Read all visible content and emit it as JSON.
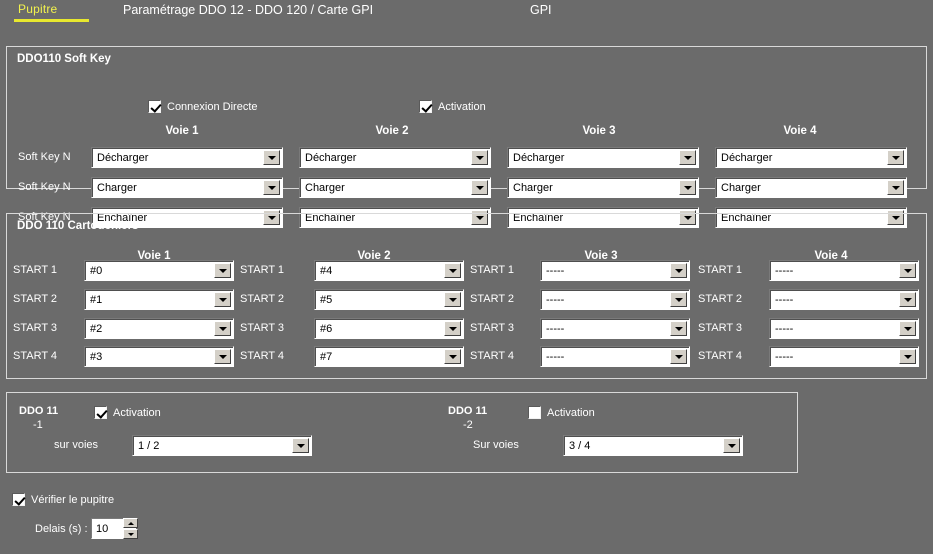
{
  "topbar": {
    "tab_label": "Pupitre",
    "title": "Paramétrage DDO 12 - DDO 120 / Carte GPI",
    "right_label": "GPI"
  },
  "softkey_panel": {
    "title": "DDO110 Soft Key",
    "connexion_directe": {
      "label": "Connexion Directe",
      "checked": true
    },
    "activation": {
      "label": "Activation",
      "checked": true
    },
    "column_headers": [
      "Voie 1",
      "Voie 2",
      "Voie 3",
      "Voie 4"
    ],
    "row_labels": [
      "Soft Key N",
      "Soft Key N",
      "Soft Key N"
    ],
    "values": [
      [
        "Décharger",
        "Décharger",
        "Décharger",
        "Décharger"
      ],
      [
        "Charger",
        "Charger",
        "Charger",
        "Charger"
      ],
      [
        "Enchaîner",
        "Enchaîner",
        "Enchaîner",
        "Enchaîner"
      ]
    ]
  },
  "cartouchiers_panel": {
    "title": "DDO 110 Cartouchiers",
    "column_headers": [
      "Voie 1",
      "Voie 2",
      "Voie 3",
      "Voie 4"
    ],
    "row_labels": [
      "START 1",
      "START 2",
      "START 3",
      "START 4"
    ],
    "values": [
      [
        "#0",
        "#4",
        "-----",
        "-----"
      ],
      [
        "#1",
        "#5",
        "-----",
        "-----"
      ],
      [
        "#2",
        "#6",
        "-----",
        "-----"
      ],
      [
        "#3",
        "#7",
        "-----",
        "-----"
      ]
    ]
  },
  "ddo11_panel": {
    "left": {
      "title": "DDO 11",
      "subtitle": "-1",
      "activation": {
        "label": "Activation",
        "checked": true
      },
      "voies_label": "sur voies",
      "voies_value": "1 / 2"
    },
    "right": {
      "title": "DDO 11",
      "subtitle": "-2",
      "activation": {
        "label": "Activation",
        "checked": false
      },
      "voies_label": "Sur voies",
      "voies_value": "3 / 4"
    }
  },
  "footer": {
    "verify": {
      "label": "Vérifier le pupitre",
      "checked": true
    },
    "delay_label": "Delais (s) :",
    "delay_value": "10"
  },
  "colors": {
    "background": "#6b6b6b",
    "accent_tab": "#e8e82e",
    "panel_border": "#d9d9d9",
    "field_bg": "#ffffff",
    "button_face": "#d4d0c8"
  }
}
